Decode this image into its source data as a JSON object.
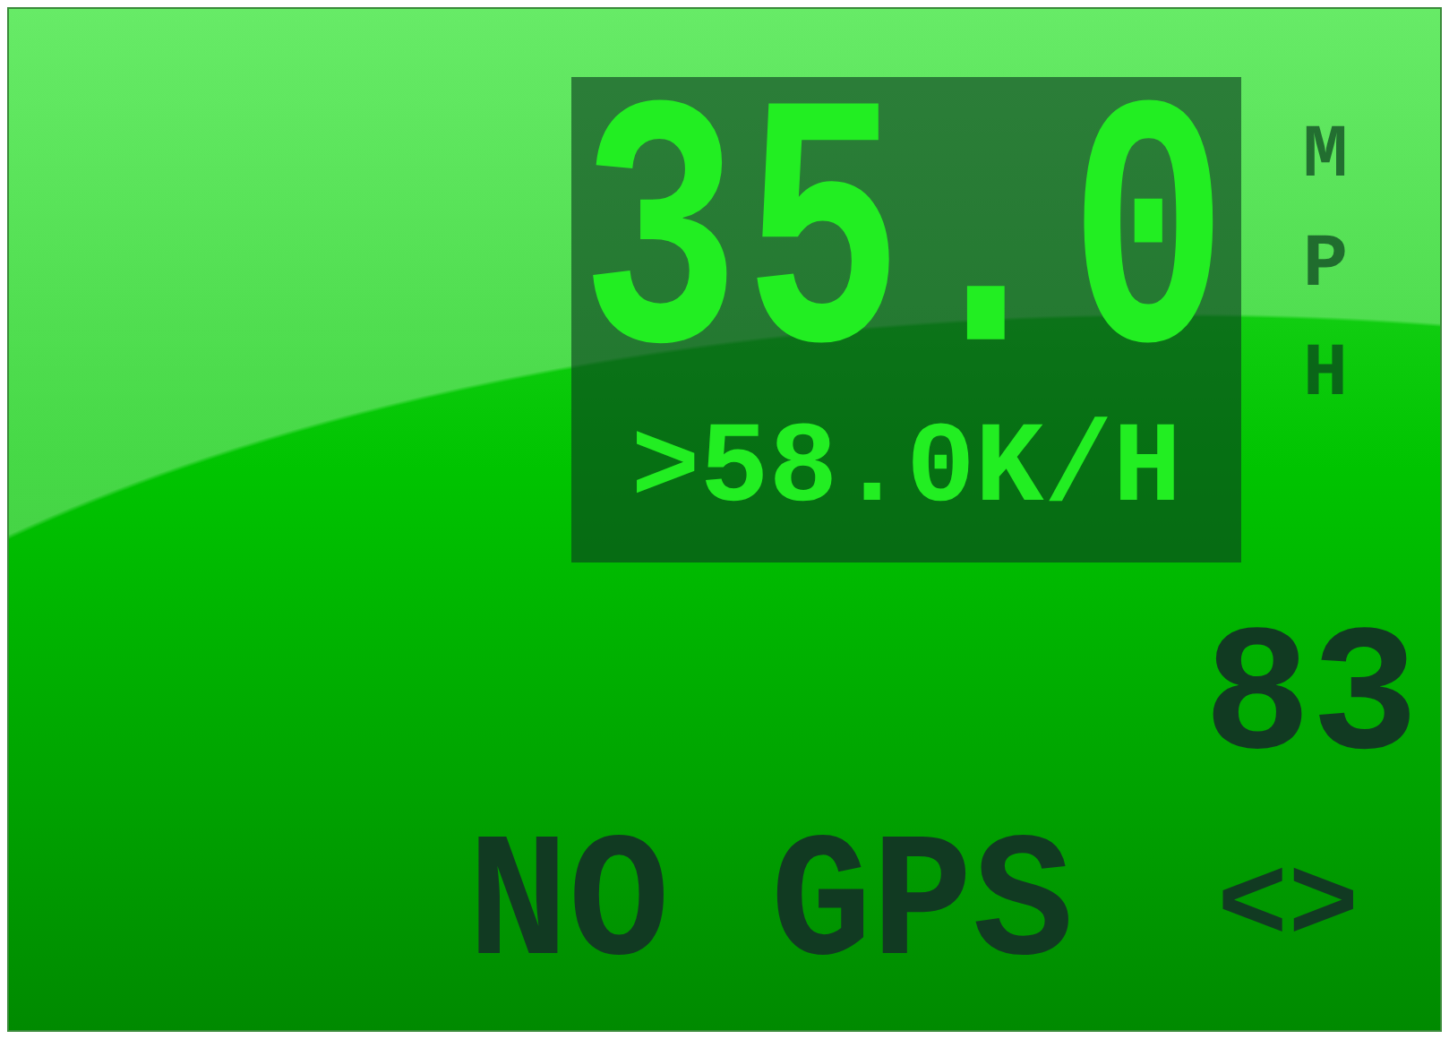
{
  "speed": {
    "value": "35.0",
    "unit": "MPH"
  },
  "secondary_speed": ">58.0K/H",
  "counter": "83",
  "gps_status": "NO GPS",
  "indicator": "<>"
}
